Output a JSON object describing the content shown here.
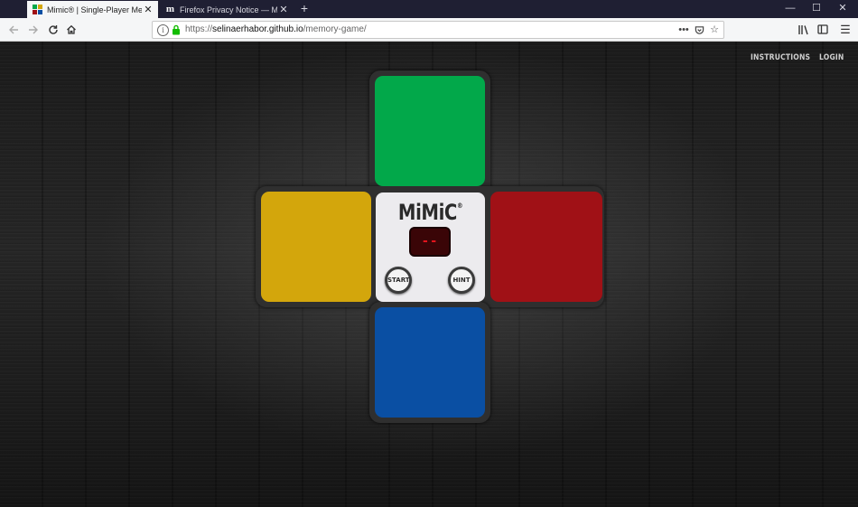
{
  "browser": {
    "tabs": [
      {
        "title": "Mimic® | Single-Player Memory Game",
        "active": true,
        "icon": "mimic-favicon"
      },
      {
        "title": "Firefox Privacy Notice — Mozilla",
        "active": false,
        "icon": "mozilla-favicon"
      }
    ],
    "new_tab": "+",
    "window_controls": {
      "minimize": "—",
      "maximize": "☐",
      "close": "✕"
    },
    "url": {
      "scheme": "https://",
      "domain": "selinaerhabor.github.io",
      "path": "/memory-game/"
    },
    "url_icons": {
      "more": "•••",
      "pocket": "pocket-icon",
      "bookmark": "☆"
    },
    "toolbar_icons": {
      "library": "library-icon",
      "sidebar": "sidebar-icon",
      "menu": "☰"
    }
  },
  "page": {
    "nav": {
      "instructions": "INSTRUCTIONS",
      "login": "LOGIN"
    },
    "game": {
      "logo": "MiMiC",
      "logo_mark": "®",
      "counter": "--",
      "start_label": "START",
      "hint_label": "HINT",
      "colors": {
        "green": "#02a84a",
        "yellow": "#d3a60c",
        "red": "#a01116",
        "blue": "#0a4fa3",
        "counter_text": "#e3141c"
      }
    }
  }
}
